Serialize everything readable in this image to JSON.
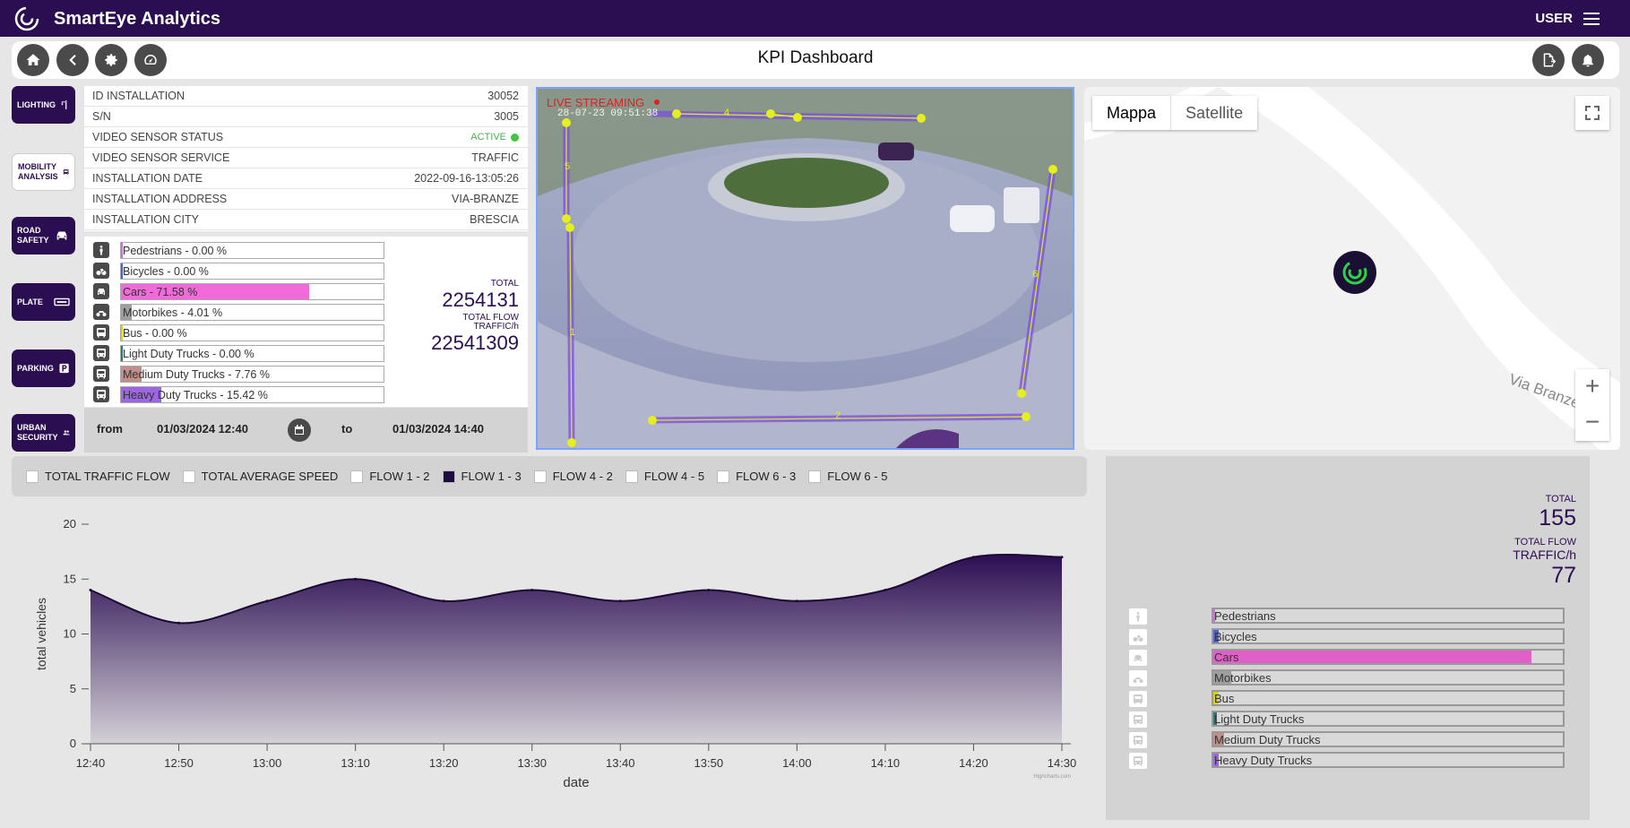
{
  "app": {
    "title": "SmartEye Analytics",
    "user": "USER"
  },
  "page": {
    "title": "KPI Dashboard"
  },
  "sidebar": [
    {
      "line1": "LIGHTING",
      "line2": "",
      "active": false,
      "icon": "lamp-icon"
    },
    {
      "line1": "MOBILITY",
      "line2": "ANALYSIS",
      "active": true,
      "icon": "bus-icon"
    },
    {
      "line1": "ROAD",
      "line2": "SAFETY",
      "active": false,
      "icon": "car-crash-icon"
    },
    {
      "line1": "PLATE",
      "line2": "",
      "active": false,
      "icon": "license-plate-icon"
    },
    {
      "line1": "PARKING",
      "line2": "",
      "active": false,
      "icon": "parking-icon"
    },
    {
      "line1": "URBAN",
      "line2": "SECURITY",
      "active": false,
      "icon": "people-icon"
    }
  ],
  "installation": [
    {
      "label": "ID INSTALLATION",
      "value": "30052"
    },
    {
      "label": "S/N",
      "value": "3005"
    },
    {
      "label": "VIDEO SENSOR STATUS",
      "value": "ACTIVE"
    },
    {
      "label": "VIDEO SENSOR SERVICE",
      "value": "TRAFFIC"
    },
    {
      "label": "INSTALLATION DATE",
      "value": "2022-09-16-13:05:26"
    },
    {
      "label": "INSTALLATION ADDRESS",
      "value": "VIA-BRANZE"
    },
    {
      "label": "INSTALLATION CITY",
      "value": "BRESCIA"
    }
  ],
  "vehicle_stats": [
    {
      "label": "Pedestrians - 0.00 %",
      "pct": 0.0,
      "color": "#d36be0",
      "icon": "pedestrian-icon"
    },
    {
      "label": "Bicycles - 0.00 %",
      "pct": 0.0,
      "color": "#4b5fd6",
      "icon": "bicycle-icon"
    },
    {
      "label": "Cars - 71.58 %",
      "pct": 71.58,
      "color": "#f06ad9",
      "icon": "car-icon"
    },
    {
      "label": "Motorbikes - 4.01 %",
      "pct": 4.01,
      "color": "#9e9e9e",
      "icon": "motorbike-icon"
    },
    {
      "label": "Bus - 0.00 %",
      "pct": 0.0,
      "color": "#d4d41c",
      "icon": "bus-icon"
    },
    {
      "label": "Light Duty Trucks - 0.00 %",
      "pct": 0.0,
      "color": "#2d7a6c",
      "icon": "truck-icon"
    },
    {
      "label": "Medium Duty Trucks - 7.76 %",
      "pct": 7.76,
      "color": "#c08f8a",
      "icon": "truck-icon"
    },
    {
      "label": "Heavy Duty Trucks - 15.42 %",
      "pct": 15.42,
      "color": "#9b66e0",
      "icon": "truck-icon"
    }
  ],
  "totals": {
    "total_label": "TOTAL",
    "total_value": "2254131",
    "flow_label_1": "TOTAL FLOW",
    "flow_label_2": "TRAFFIC/h",
    "flow_value": "22541309"
  },
  "daterange": {
    "from_label": "from",
    "from_value": "01/03/2024 12:40",
    "to_label": "to",
    "to_value": "01/03/2024 14:40"
  },
  "video": {
    "overlay_text": "LIVE STREAMING",
    "timestamp": "28-07-23 09:51:38",
    "zone_labels": [
      "4",
      "5",
      "1",
      "6",
      "2"
    ]
  },
  "map": {
    "tab_map": "Mappa",
    "tab_satellite": "Satellite",
    "road_label": "Via Branze",
    "zoom_in": "+",
    "zoom_out": "−"
  },
  "legend": [
    {
      "label": "TOTAL TRAFFIC FLOW",
      "checked": false
    },
    {
      "label": "TOTAL AVERAGE SPEED",
      "checked": false
    },
    {
      "label": "FLOW 1 - 2",
      "checked": false
    },
    {
      "label": "FLOW 1 - 3",
      "checked": true
    },
    {
      "label": "FLOW 4 - 2",
      "checked": false
    },
    {
      "label": "FLOW 4 - 5",
      "checked": false
    },
    {
      "label": "FLOW 6 - 3",
      "checked": false
    },
    {
      "label": "FLOW 6 - 5",
      "checked": false
    }
  ],
  "chart_data": {
    "type": "area",
    "x": [
      "12:40",
      "12:50",
      "13:00",
      "13:10",
      "13:20",
      "13:30",
      "13:40",
      "13:50",
      "14:00",
      "14:10",
      "14:20",
      "14:30"
    ],
    "series": [
      {
        "values": [
          14,
          11,
          13,
          15,
          13,
          14,
          13,
          14,
          13,
          14,
          17,
          17
        ]
      }
    ],
    "xlabel": "date",
    "ylabel": "total vehicles",
    "ylim": [
      0,
      20
    ],
    "yticks": [
      0,
      5,
      10,
      15,
      20
    ],
    "credit": "Highcharts.com",
    "color": "#2b0d52"
  },
  "summary": {
    "total_label": "TOTAL",
    "total_value": "155",
    "flow_label_1": "TOTAL FLOW",
    "flow_label_2": "TRAFFIC/h",
    "flow_value": "77",
    "bars": [
      {
        "label": "Pedestrians",
        "pct": 0.0,
        "color": "#d36be0",
        "icon": "pedestrian-icon"
      },
      {
        "label": "Bicycles",
        "pct": 1.5,
        "color": "#4b5fd6",
        "icon": "bicycle-icon"
      },
      {
        "label": "Cars",
        "pct": 91,
        "color": "#e060c8",
        "icon": "car-icon"
      },
      {
        "label": "Motorbikes",
        "pct": 5,
        "color": "#9e9e9e",
        "icon": "motorbike-icon"
      },
      {
        "label": "Bus",
        "pct": 1.5,
        "color": "#d4d41c",
        "icon": "bus-icon"
      },
      {
        "label": "Light Duty Trucks",
        "pct": 1,
        "color": "#2d7a6c",
        "icon": "truck-icon"
      },
      {
        "label": "Medium Duty Trucks",
        "pct": 3,
        "color": "#c08f8a",
        "icon": "truck-icon"
      },
      {
        "label": "Heavy Duty Trucks",
        "pct": 1.5,
        "color": "#9b66e0",
        "icon": "truck-icon"
      }
    ]
  }
}
